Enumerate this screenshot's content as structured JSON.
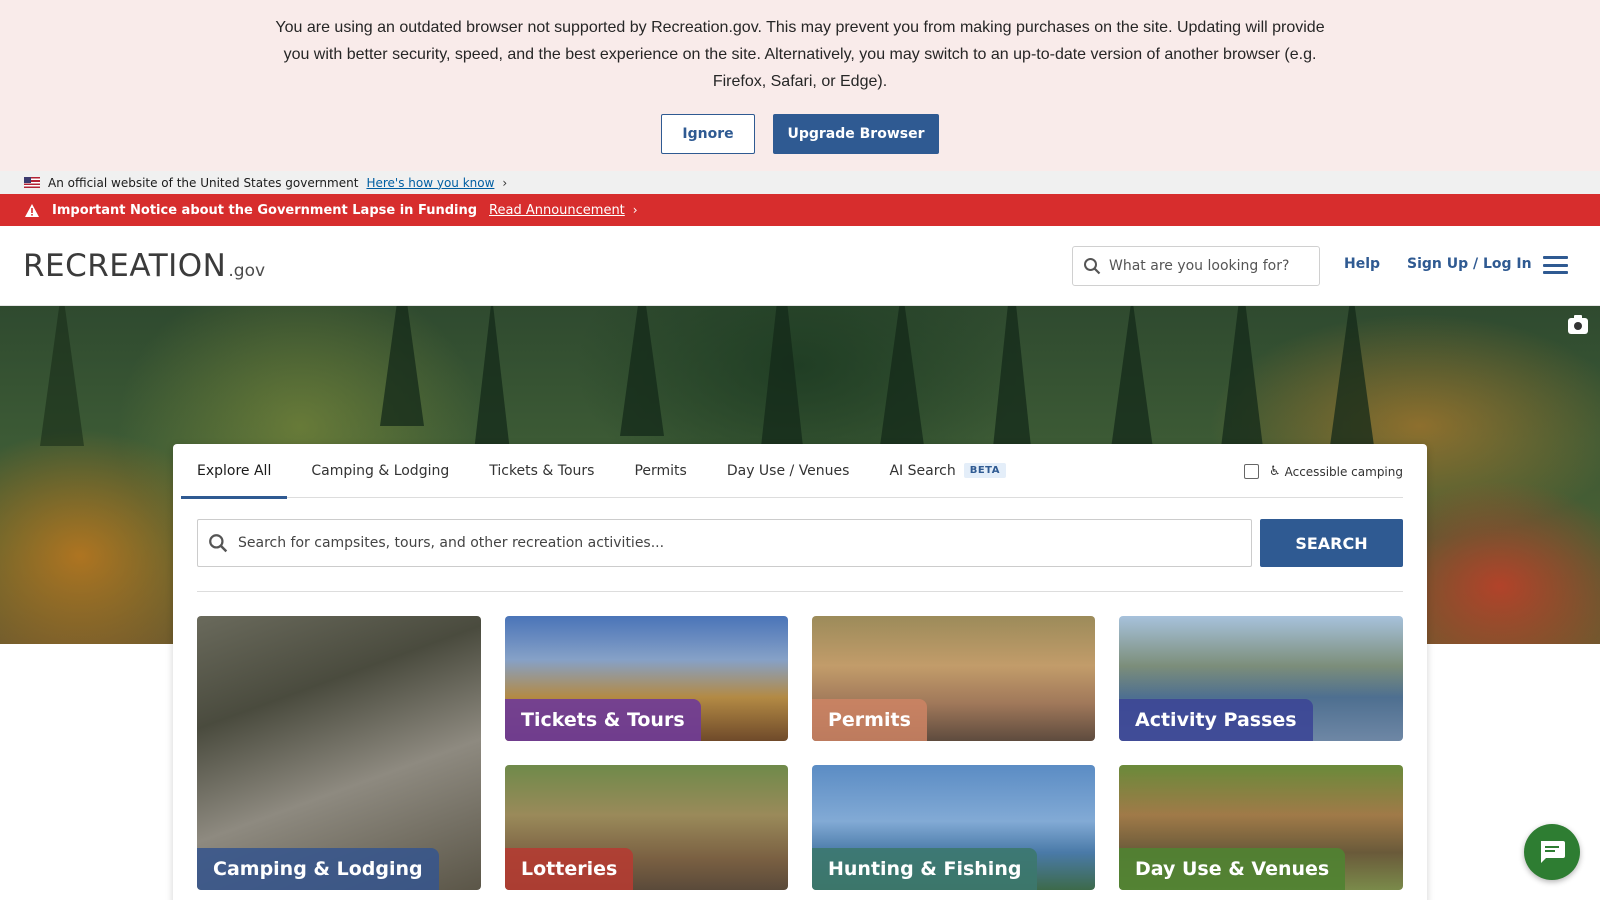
{
  "browser_banner": {
    "message": "You are using an outdated browser not supported by Recreation.gov. This may prevent you from making purchases on the site. Updating will provide you with better security, speed, and the best experience on the site. Alternatively, you may switch to an up-to-date version of another browser (e.g. Firefox, Safari, or Edge).",
    "ignore_label": "Ignore",
    "upgrade_label": "Upgrade Browser"
  },
  "gov_banner": {
    "text": "An official website of the United States government",
    "link": "Here's how you know"
  },
  "notice": {
    "title": "Important Notice about the Government Lapse in Funding",
    "link": "Read Announcement",
    "color": "#d72d2d"
  },
  "header": {
    "logo_word": "RECREATION",
    "logo_tld": ".gov",
    "search_placeholder": "What are you looking for?",
    "help": "Help",
    "login": "Sign Up / Log In"
  },
  "search_card": {
    "tabs": [
      {
        "label": "Explore All",
        "active": true
      },
      {
        "label": "Camping & Lodging"
      },
      {
        "label": "Tickets & Tours"
      },
      {
        "label": "Permits"
      },
      {
        "label": "Day Use / Venues"
      },
      {
        "label": "AI Search",
        "badge": "BETA"
      }
    ],
    "accessible_label": "Accessible camping",
    "search_placeholder": "Search for campsites, tours, and other recreation activities...",
    "search_button": "SEARCH"
  },
  "tiles": [
    {
      "label": "Camping & Lodging"
    },
    {
      "label": "Tickets & Tours"
    },
    {
      "label": "Permits"
    },
    {
      "label": "Activity Passes"
    },
    {
      "label": "Lotteries"
    },
    {
      "label": "Hunting & Fishing"
    },
    {
      "label": "Day Use & Venues"
    }
  ],
  "colors": {
    "primary": "#2f5a92",
    "banner_bg": "#f9ebea",
    "chat": "#2e7d32"
  }
}
